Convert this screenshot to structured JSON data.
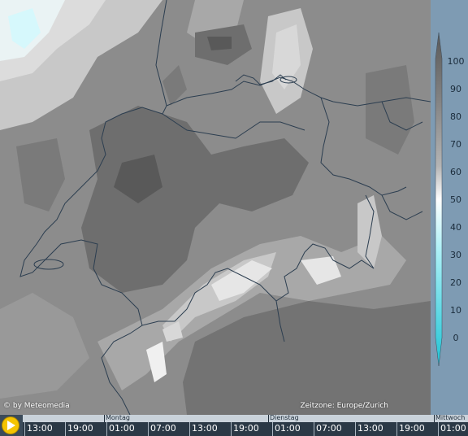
{
  "copyright": "© by Meteomedia",
  "timezone": "Zeitzone: Europe/Zurich",
  "legend": {
    "labels": [
      "100",
      "90",
      "80",
      "70",
      "60",
      "50",
      "40",
      "30",
      "20",
      "10",
      "0"
    ],
    "colors": [
      "#595959",
      "#6e6e6e",
      "#828282",
      "#969696",
      "#b4b4b4",
      "#ffffff",
      "#d6f8fc",
      "#aef0f7",
      "#7ee6f1",
      "#4cd8e6",
      "#1fc3d4"
    ]
  },
  "timeline": {
    "days": [
      "Montag",
      "Dienstag",
      "Mittwoch"
    ],
    "hours": [
      "13:00",
      "19:00",
      "01:00",
      "07:00",
      "13:00",
      "19:00",
      "01:00",
      "07:00",
      "13:00",
      "19:00",
      "01:00"
    ]
  },
  "icons": {
    "play": "play-icon"
  }
}
